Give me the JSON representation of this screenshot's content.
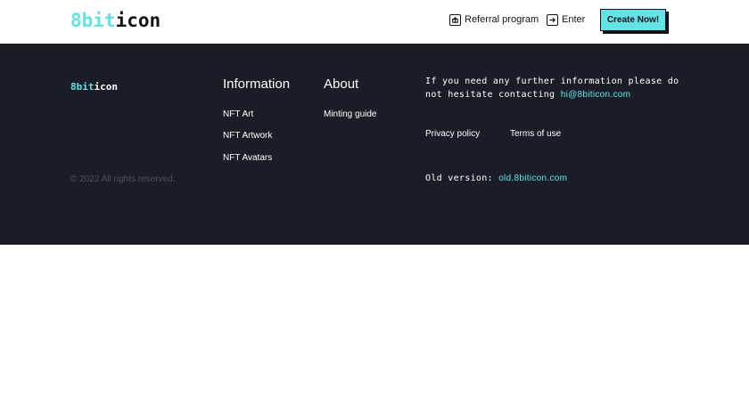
{
  "header": {
    "logo": {
      "part_a": "8bit",
      "part_b": "icon"
    },
    "nav": {
      "referral": {
        "label": "Referral program",
        "icon": "gift-icon"
      },
      "enter": {
        "label": "Enter",
        "icon": "login-arrow-icon"
      }
    },
    "cta_label": "Create Now!"
  },
  "footer": {
    "logo": {
      "part_a": "8bit",
      "part_b": "icon"
    },
    "copyright": "© 2022 All rights reserved.",
    "information": {
      "title": "Information",
      "links": [
        "NFT Art",
        "NFT Artwork",
        "NFT Avatars"
      ]
    },
    "about": {
      "title": "About",
      "links": [
        "Minting guide"
      ]
    },
    "contact": {
      "text": "If you need any further information please do not hesitate contacting",
      "email": "hi@8biticon.com"
    },
    "legal": {
      "privacy": "Privacy policy",
      "terms": "Terms of use"
    },
    "old_version": {
      "label": "Old version:",
      "link": "old.8biticon.com"
    }
  },
  "colors": {
    "accent": "#63e3e6",
    "footer_bg": "#1a1d27",
    "text_dark": "#111318"
  }
}
